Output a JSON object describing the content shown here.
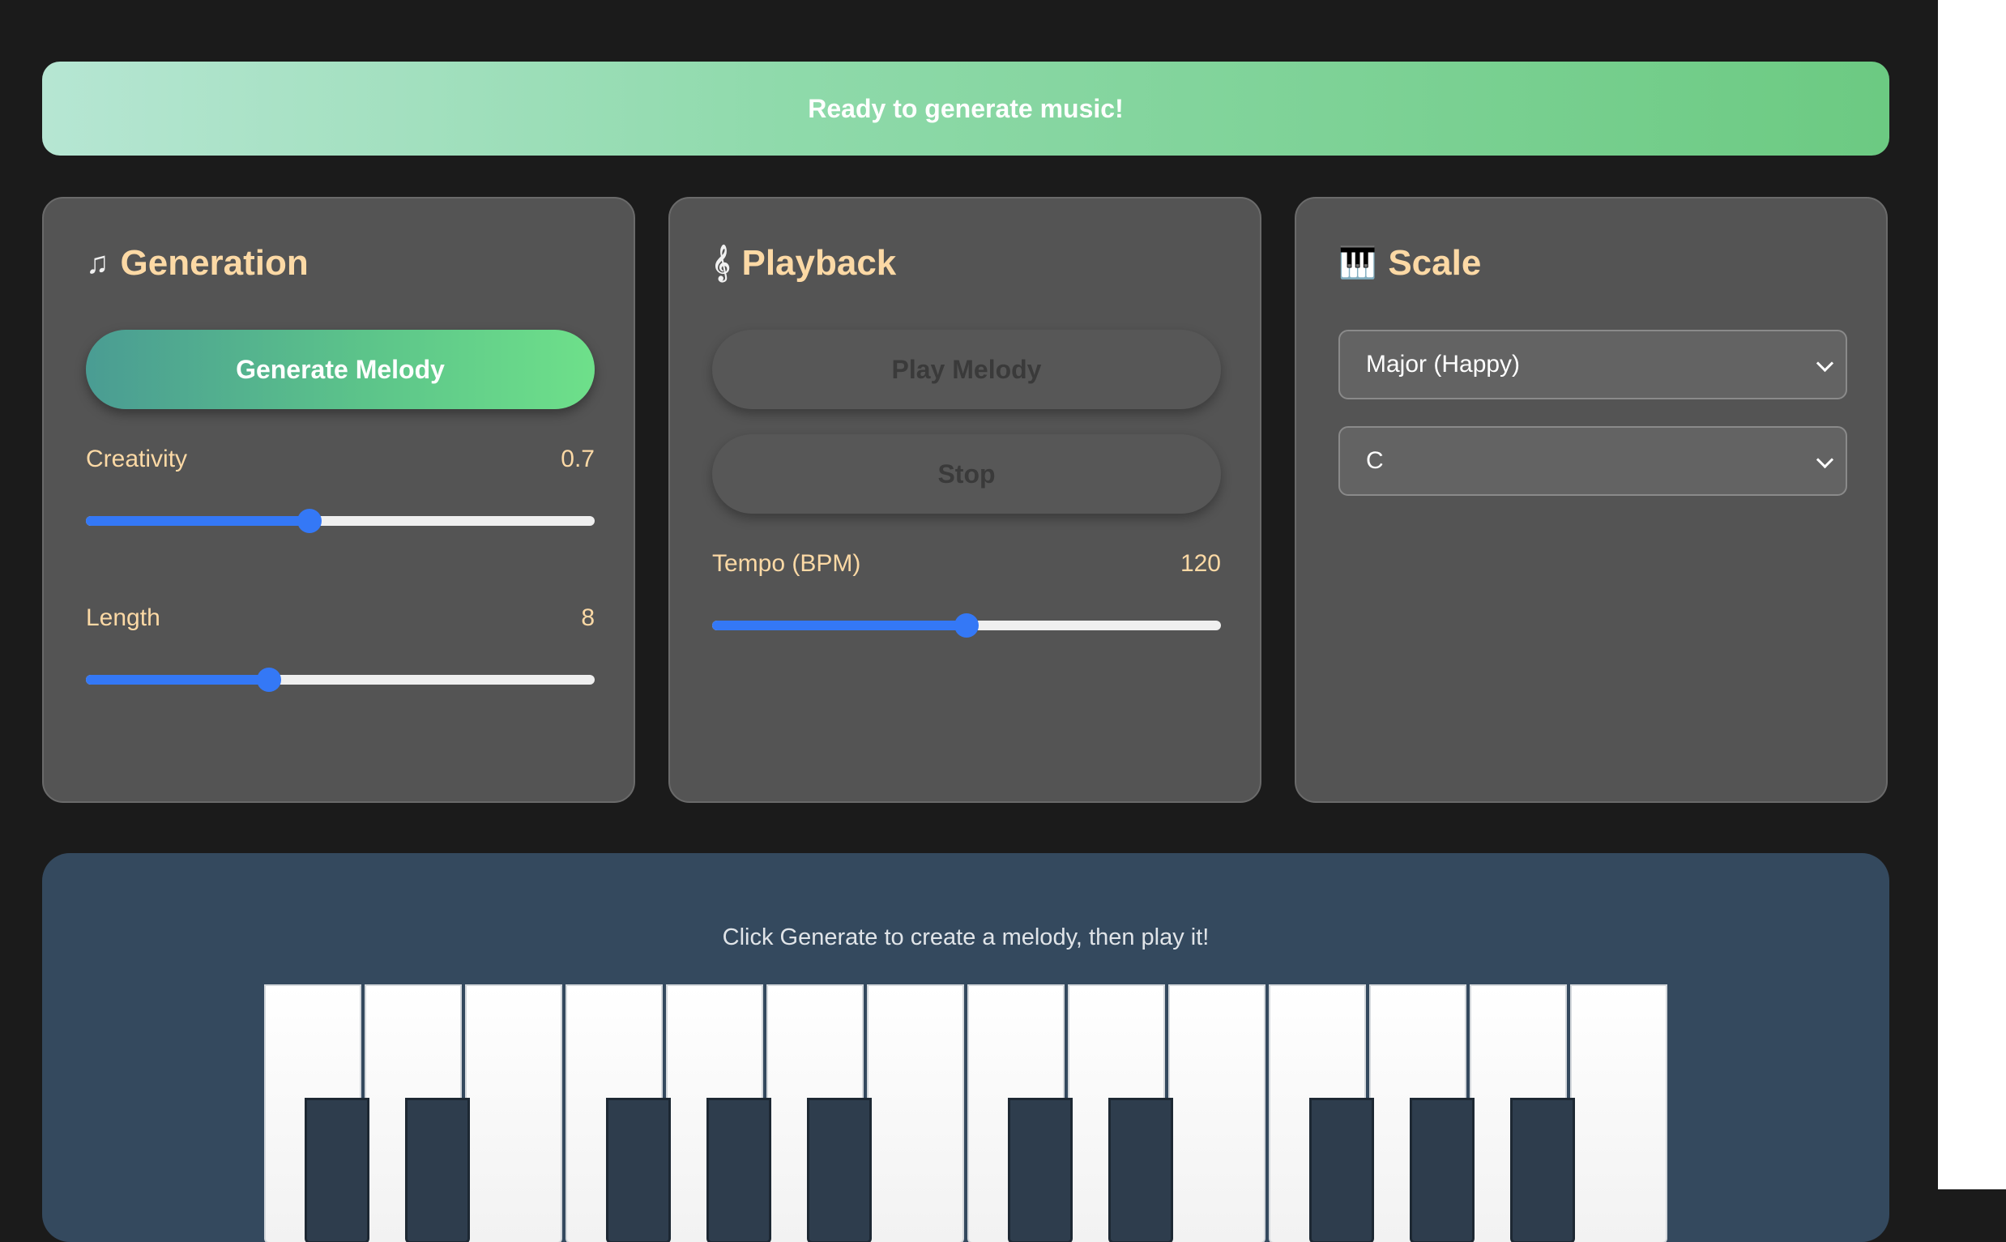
{
  "status": {
    "message": "Ready to generate music!"
  },
  "generation": {
    "icon": "music-note-icon",
    "title": "Generation",
    "generate_button": "Generate Melody",
    "creativity": {
      "label": "Creativity",
      "value": "0.7",
      "fraction": 0.44
    },
    "length": {
      "label": "Length",
      "value": "8",
      "fraction": 0.36
    }
  },
  "playback": {
    "icon": "music-score-icon",
    "title": "Playback",
    "play_button": "Play Melody",
    "stop_button": "Stop",
    "tempo": {
      "label": "Tempo (BPM)",
      "value": "120",
      "fraction": 0.5
    }
  },
  "scale": {
    "icon": "piano-keys-icon",
    "title": "Scale",
    "mode_selected": "Major (Happy)",
    "key_selected": "C"
  },
  "piano": {
    "hint": "Click Generate to create a melody, then play it!",
    "white_key_count": 14,
    "black_key_after_white_index": [
      0,
      1,
      3,
      4,
      5,
      7,
      8,
      10,
      11,
      12
    ]
  },
  "colors": {
    "accent": "#3478f6",
    "title_text": "#fcd9a5",
    "panel_bg": "#545454",
    "piano_bg": "#34495e"
  }
}
